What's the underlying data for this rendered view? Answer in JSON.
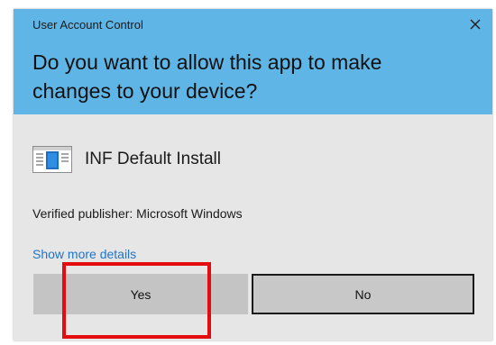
{
  "window": {
    "title": "User Account Control",
    "close_icon": "close-icon"
  },
  "prompt": {
    "question": "Do you want to allow this app to make changes to your device?"
  },
  "app": {
    "name": "INF Default Install",
    "icon": "app-window-icon"
  },
  "publisher": {
    "text": "Verified publisher: Microsoft Windows"
  },
  "details": {
    "link_label": "Show more details"
  },
  "buttons": {
    "yes_label": "Yes",
    "no_label": "No"
  },
  "colors": {
    "header_bg": "#5fb5e6",
    "body_bg": "#e6e6e6",
    "link": "#1f74c9",
    "highlight": "#e40d0d"
  }
}
